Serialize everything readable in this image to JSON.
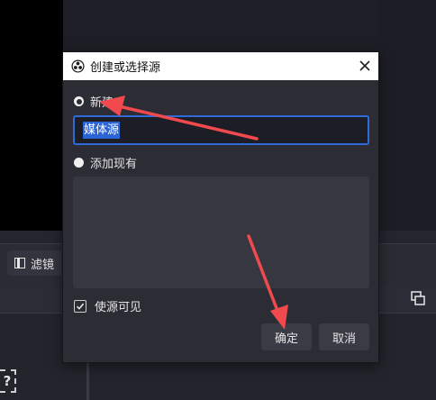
{
  "toolbar": {
    "filters_label": "滤镜"
  },
  "dialog": {
    "title": "创建或选择源",
    "radio_new_label": "新建",
    "name_value": "媒体源",
    "radio_existing_label": "添加现有",
    "visible_checkbox_label": "使源可见",
    "visible_checked": true,
    "ok_label": "确定",
    "cancel_label": "取消"
  },
  "annotations": {
    "arrow_color": "#f04a4f"
  },
  "colors": {
    "accent": "#2f6bd8",
    "dialog_bg": "#2b2c34"
  }
}
